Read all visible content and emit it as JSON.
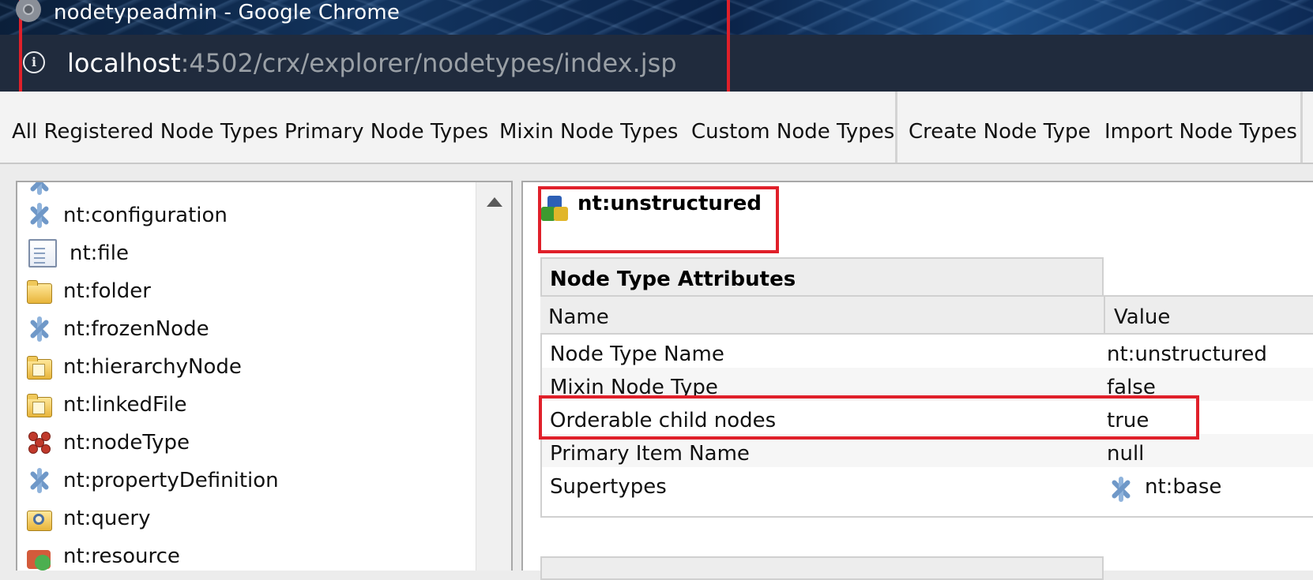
{
  "window": {
    "title": "nodetypeadmin - Google Chrome"
  },
  "address_bar": {
    "host": "localhost",
    "path": ":4502/crx/explorer/nodetypes/index.jsp"
  },
  "menu": {
    "items": [
      "All Registered Node Types",
      "Primary Node Types",
      "Mixin Node Types",
      "Custom Node Types",
      "Create Node Type",
      "Import Node Types"
    ]
  },
  "tree": {
    "items": [
      {
        "label": "nt:configuration",
        "icon": "mixin-node-icon"
      },
      {
        "label": "nt:file",
        "icon": "file-icon"
      },
      {
        "label": "nt:folder",
        "icon": "folder-icon"
      },
      {
        "label": "nt:frozenNode",
        "icon": "mixin-node-icon"
      },
      {
        "label": "nt:hierarchyNode",
        "icon": "folder-icon"
      },
      {
        "label": "nt:linkedFile",
        "icon": "folder-icon"
      },
      {
        "label": "nt:nodeType",
        "icon": "nodetype-icon"
      },
      {
        "label": "nt:propertyDefinition",
        "icon": "mixin-node-icon"
      },
      {
        "label": "nt:query",
        "icon": "query-icon"
      },
      {
        "label": "nt:resource",
        "icon": "resource-icon"
      }
    ]
  },
  "detail": {
    "title": "nt:unstructured",
    "attributes_header": "Node Type Attributes",
    "col_name": "Name",
    "col_value": "Value",
    "rows": [
      {
        "name": "Node Type Name",
        "value": "nt:unstructured"
      },
      {
        "name": "Mixin Node Type",
        "value": "false"
      },
      {
        "name": "Orderable child nodes",
        "value": "true"
      },
      {
        "name": "Primary Item Name",
        "value": "null"
      },
      {
        "name": "Supertypes",
        "value": "nt:base"
      }
    ]
  },
  "colors": {
    "highlight": "#e0202a",
    "address_bar_bg": "#202b3d"
  }
}
